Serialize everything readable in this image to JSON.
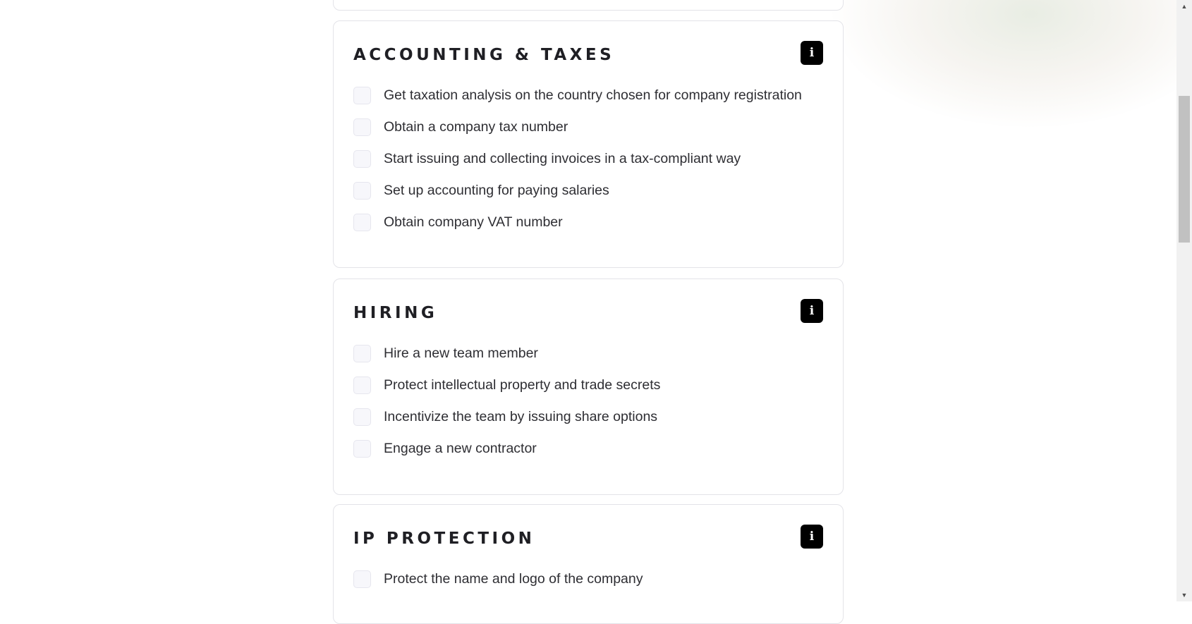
{
  "sections": [
    {
      "title": "ACCOUNTING & TAXES",
      "info_icon": "info-icon",
      "items": [
        "Get taxation analysis on the country chosen for company registration",
        "Obtain a company tax number",
        "Start issuing and collecting invoices in a tax-compliant way",
        "Set up accounting for paying salaries",
        "Obtain company VAT number"
      ]
    },
    {
      "title": "HIRING",
      "info_icon": "info-icon",
      "items": [
        "Hire a new team member",
        "Protect intellectual property and trade secrets",
        "Incentivize the team by issuing share options",
        "Engage a new contractor"
      ]
    },
    {
      "title": "IP PROTECTION",
      "info_icon": "info-icon",
      "items": [
        "Protect the name and logo of the company"
      ]
    }
  ],
  "info_glyph": "i",
  "scrollbar": {
    "up_arrow": "▲",
    "down_arrow": "▼"
  },
  "colors": {
    "info_button_bg": "#000000",
    "card_border": "#e3e3e8",
    "checkbox_bg": "#f7f7fb",
    "heading_text": "#1f1f24"
  }
}
